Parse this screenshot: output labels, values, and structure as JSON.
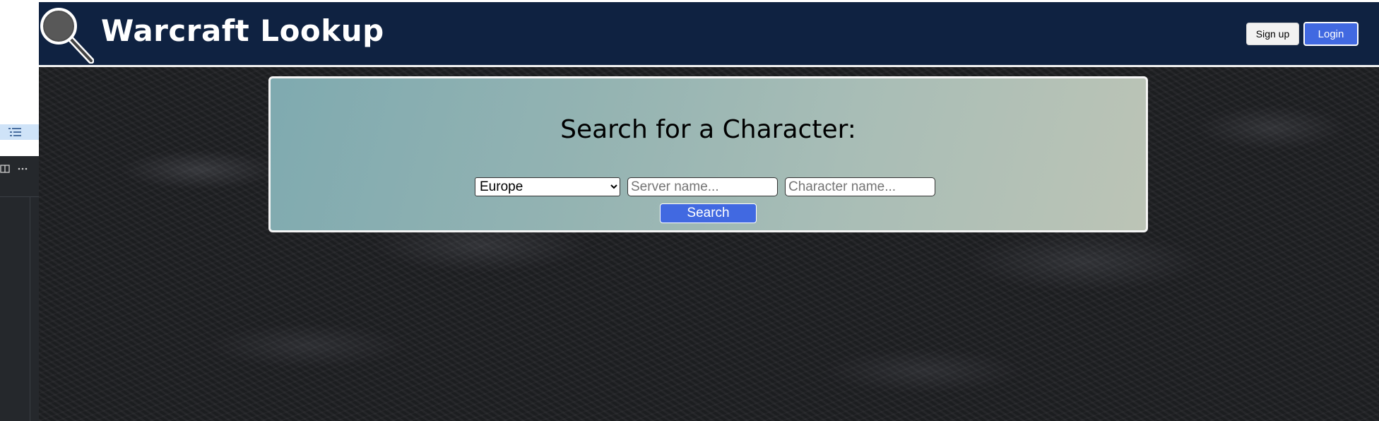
{
  "header": {
    "title": "Warcraft Lookup",
    "signup_label": "Sign up",
    "login_label": "Login",
    "background_color": "#0f2241",
    "accent_color": "#4169e1"
  },
  "search": {
    "heading": "Search for a Character:",
    "region_selected": "Europe",
    "region_options": [
      "Europe"
    ],
    "server_placeholder": "Server name...",
    "character_placeholder": "Character name...",
    "button_label": "Search"
  },
  "left_strip": {
    "icons": [
      "list-icon",
      "split-view-icon",
      "more-icon"
    ]
  }
}
